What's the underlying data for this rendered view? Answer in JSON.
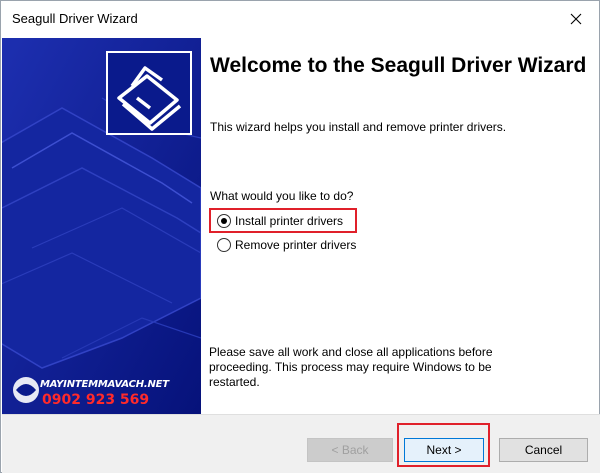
{
  "window": {
    "title": "Seagull Driver Wizard"
  },
  "side_panel": {
    "watermark_site": "MAYINTEMMAVACH.NET",
    "watermark_phone": "0902 923 569"
  },
  "content": {
    "heading": "Welcome to the Seagull Driver Wizard",
    "intro": "This wizard helps you install and remove printer drivers.",
    "question": "What would you like to do?",
    "options": [
      {
        "label": "Install printer drivers",
        "selected": true
      },
      {
        "label": "Remove printer drivers",
        "selected": false
      }
    ],
    "notice": "Please save all work and close all applications before proceeding.  This process may require Windows to be restarted."
  },
  "footer": {
    "back_label": "< Back",
    "next_label": "Next >",
    "cancel_label": "Cancel"
  },
  "colors": {
    "side_panel_bg": "#0a1a8c",
    "highlight": "#e0202a",
    "watermark_phone": "#ff2a2a"
  }
}
